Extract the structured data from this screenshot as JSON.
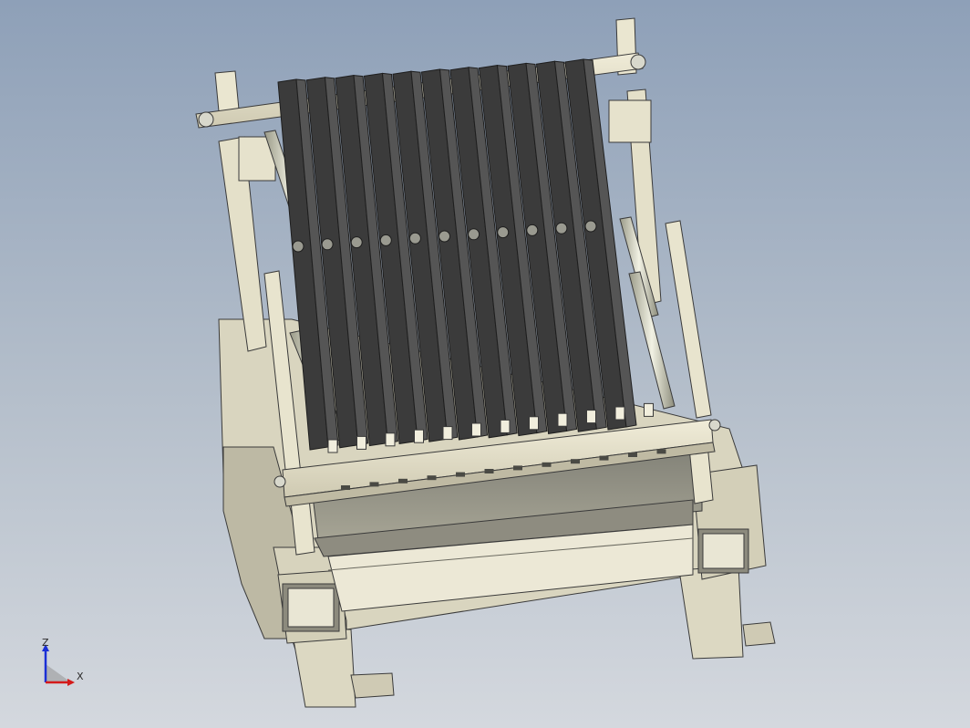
{
  "view": {
    "background_top": "#8ea0b8",
    "background_bottom": "#d4d8de"
  },
  "model": {
    "frame_color": "#e6e2cc",
    "frame_edge": "#3a3a3a",
    "plate_dark": "#3b3b3b",
    "plate_mid": "#555555",
    "rod_color": "#cfcfb8",
    "plate_count": 11,
    "slot_count": 12
  },
  "triad": {
    "z_label": "Z",
    "x_label": "X",
    "z_color": "#1a2fd6",
    "x_color": "#d41a1a"
  }
}
